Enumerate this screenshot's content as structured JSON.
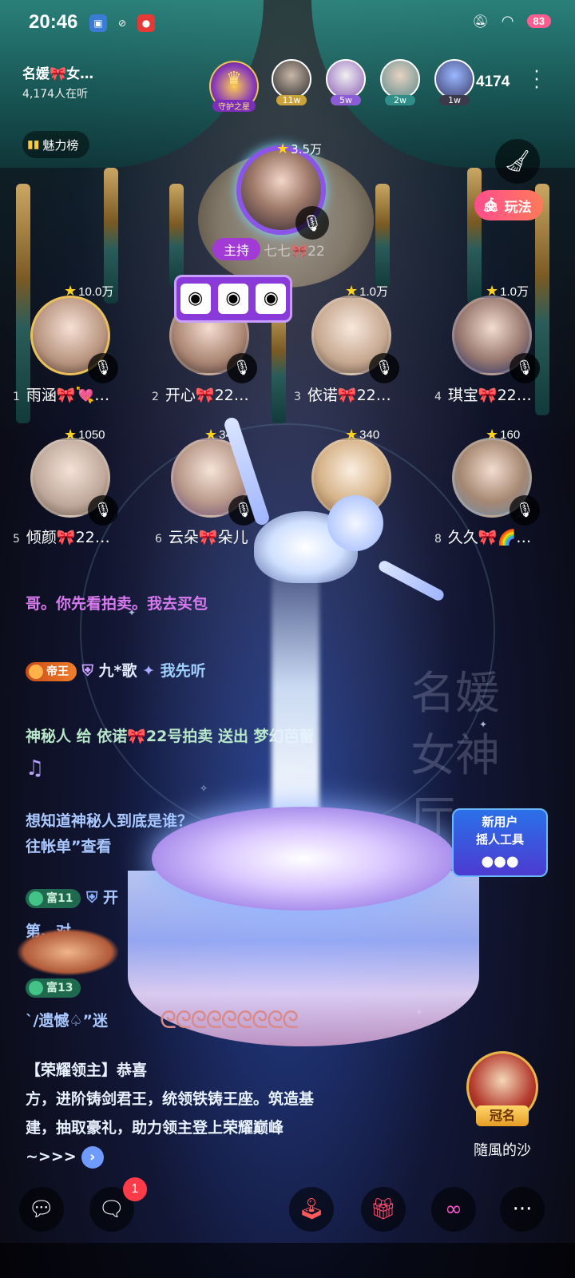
{
  "status_bar": {
    "time": "20:46",
    "battery": "83"
  },
  "room": {
    "name": "名媛🎀女…",
    "listeners": "4,174人在听",
    "guard_label": "守护之星",
    "online_count": "4174",
    "charm_rank": "魅力榜",
    "play_label": "玩法"
  },
  "top_fans": [
    {
      "count": "11w"
    },
    {
      "count": "5w"
    },
    {
      "count": "2w"
    },
    {
      "count": "1w"
    }
  ],
  "host": {
    "score": "3.5万",
    "tag": "主持",
    "name": "七七🎀22"
  },
  "seats": [
    {
      "num": "1",
      "name": "雨涵🎀💘…",
      "score": "10.0万"
    },
    {
      "num": "2",
      "name": "开心🎀22…",
      "score": ""
    },
    {
      "num": "3",
      "name": "依诺🎀22…",
      "score": "1.0万"
    },
    {
      "num": "4",
      "name": "琪宝🎀22…",
      "score": "1.0万"
    },
    {
      "num": "5",
      "name": "倾颜🎀22…",
      "score": "1050"
    },
    {
      "num": "6",
      "name": "云朵🎀朵儿",
      "score": "340"
    },
    {
      "num": "7",
      "name": "",
      "score": "340"
    },
    {
      "num": "8",
      "name": "久久🎀🌈…",
      "score": "160"
    }
  ],
  "chat": [
    {
      "text": "哥。你先看拍卖。我去买包",
      "color": "#d97bf0"
    },
    {
      "badge": "帝王",
      "user": "九*歌",
      "text": "我先听",
      "color": "#9fd0ff"
    },
    {
      "text": "神秘人 给 依诺🎀22号拍卖 送出 梦幻芭蕾",
      "color": "#b7e6c8"
    },
    {
      "text": "想知道神秘人到底是谁？",
      "color": "#a9c8ff"
    },
    {
      "text": "往帐单”查看",
      "color": "#a9c8ff"
    },
    {
      "badge": "富11",
      "user": "开",
      "color": "#a9c8ff"
    },
    {
      "text": "第…对…",
      "color": "#a9c8ff"
    },
    {
      "badge": "富13",
      "color": "#a9c8ff"
    },
    {
      "text": "`/遗憾♤”迷",
      "color": "#a9c8ff"
    }
  ],
  "announcement": {
    "line1": "【荣耀领主】恭喜",
    "line2": "方，进阶铸剑君王，统领铁铸王座。筑造基",
    "line3": "建，抽取豪礼，助力领主登上荣耀巅峰",
    "line4": "~>>>"
  },
  "watermark": "名媛女神厅",
  "new_user_card": {
    "line1": "新用户",
    "line2": "摇人工具"
  },
  "sponsor": {
    "tag": "冠名",
    "name": "隨風的沙"
  },
  "bottom_bar": {
    "message_badge": "1"
  },
  "colors": {
    "accent_pink": "#ff4d8e",
    "host_purple": "#a23ad6",
    "battery": "#ff5c8f"
  },
  "icons": [
    "chat-bubble-icon",
    "message-icon",
    "joystick-icon",
    "gift-icon",
    "link-icon",
    "more-icon",
    "broom-icon",
    "mic-icon",
    "mic-off-icon",
    "star-icon"
  ]
}
